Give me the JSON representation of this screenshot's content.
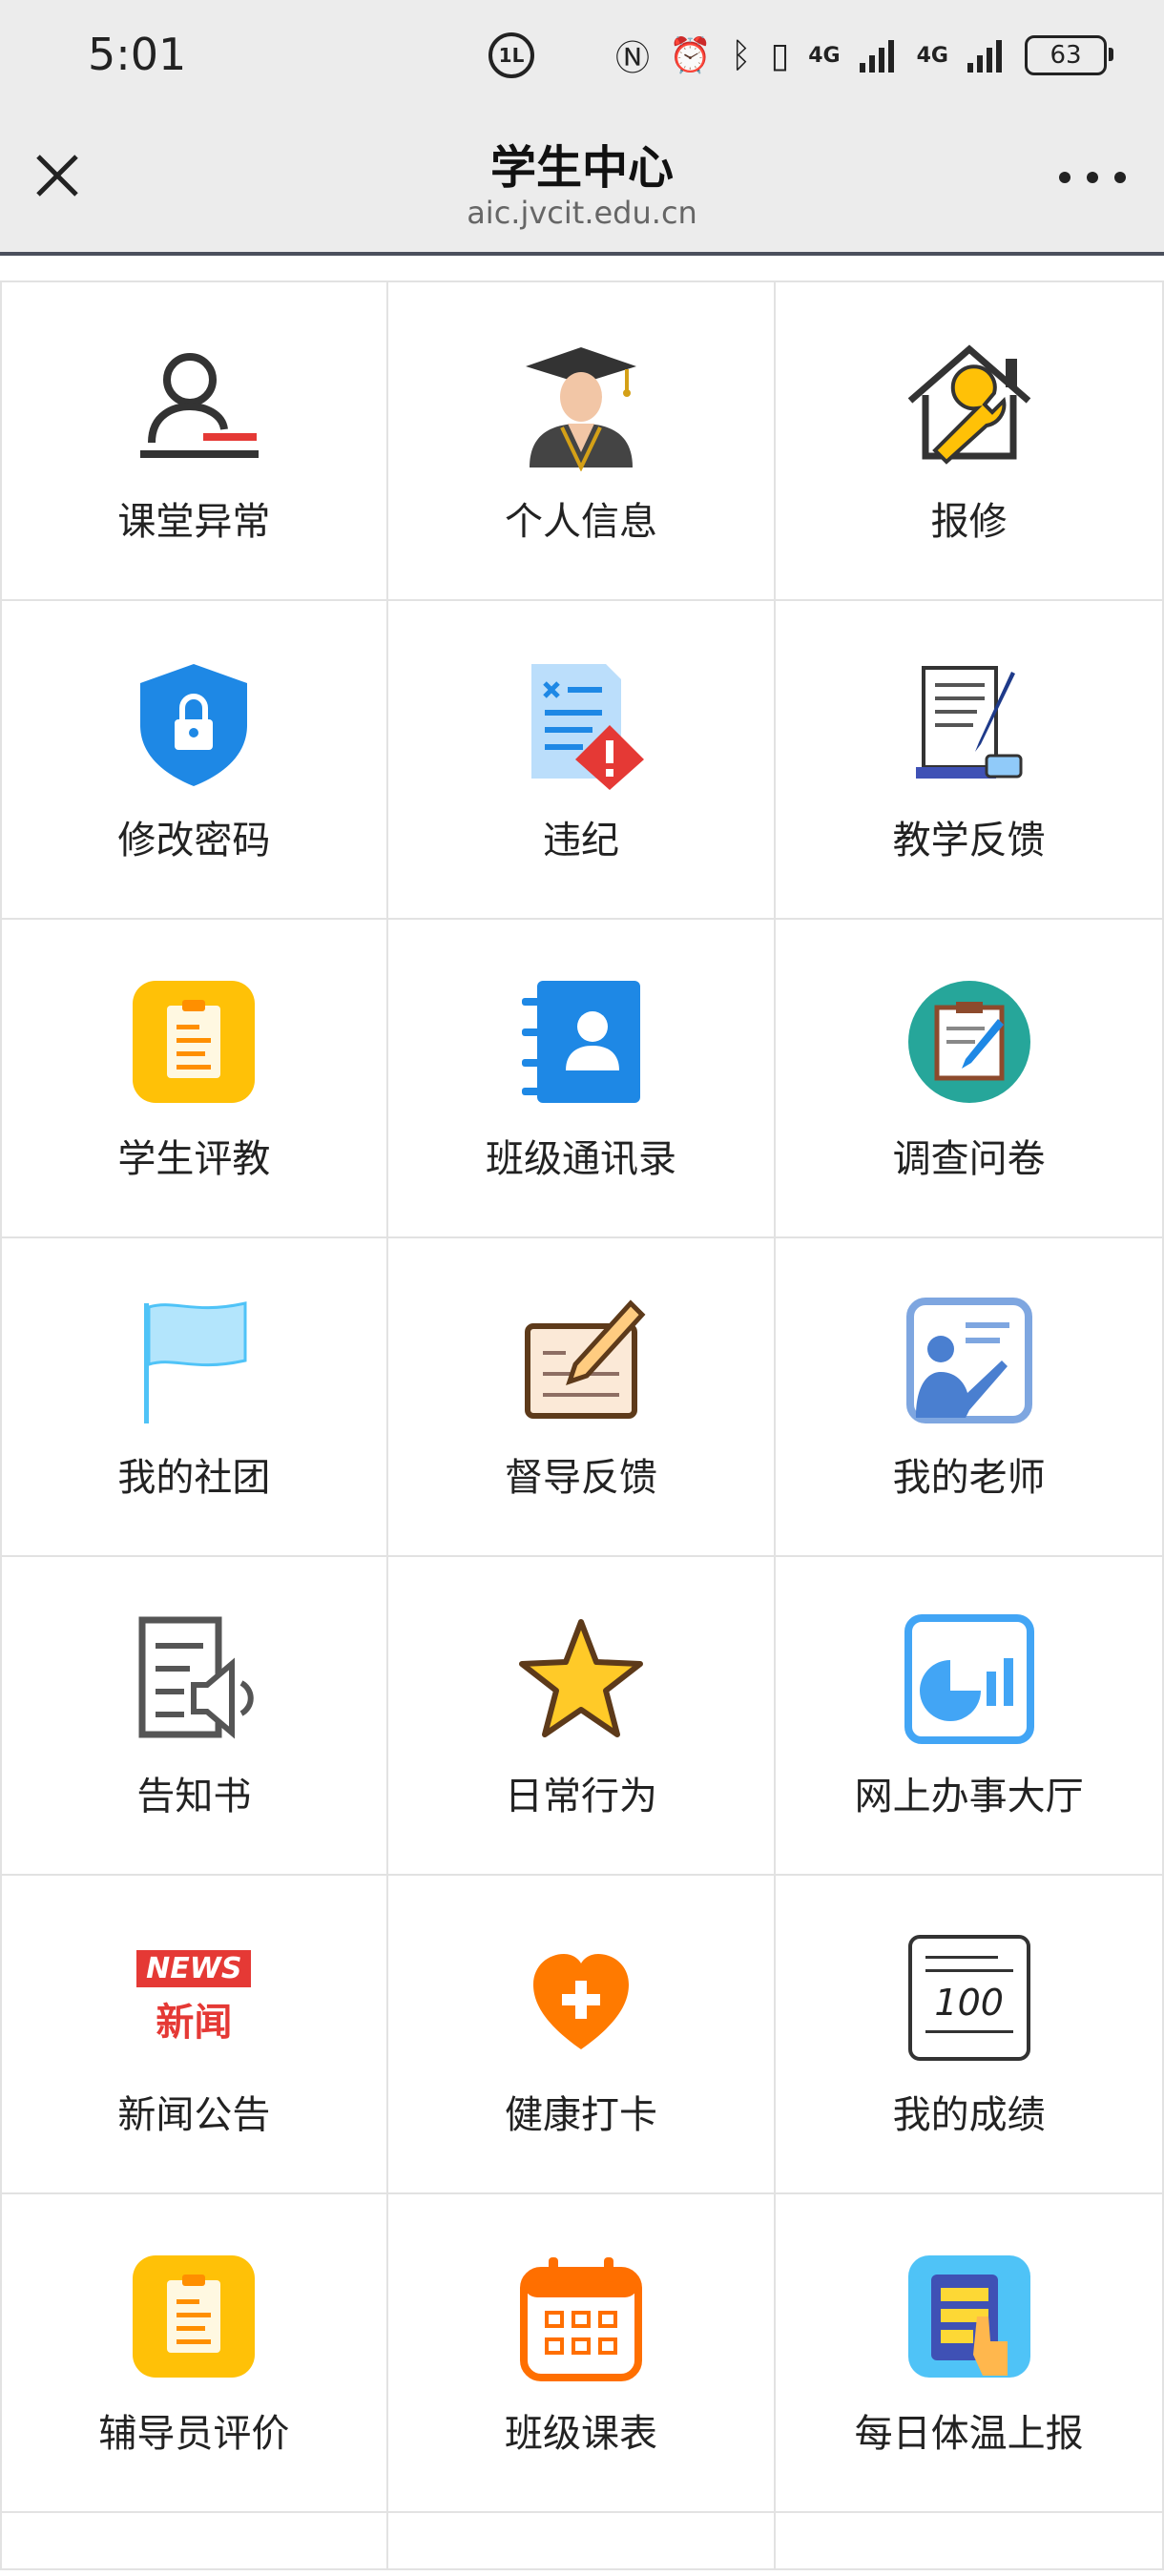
{
  "status_bar": {
    "time": "5:01",
    "net1": "4G",
    "net2": "4G",
    "battery": "63",
    "dnd_label": "1L"
  },
  "header": {
    "title": "学生中心",
    "url": "aic.jvcit.edu.cn"
  },
  "grid": {
    "items": [
      {
        "label": "课堂异常",
        "icon": "person-red-line-icon"
      },
      {
        "label": "个人信息",
        "icon": "graduate-icon"
      },
      {
        "label": "报修",
        "icon": "house-wrench-icon"
      },
      {
        "label": "修改密码",
        "icon": "shield-lock-icon"
      },
      {
        "label": "违纪",
        "icon": "document-warning-icon"
      },
      {
        "label": "教学反馈",
        "icon": "scroll-pen-icon"
      },
      {
        "label": "学生评教",
        "icon": "clipboard-yellow-icon"
      },
      {
        "label": "班级通讯录",
        "icon": "contact-book-icon"
      },
      {
        "label": "调查问卷",
        "icon": "survey-circle-icon"
      },
      {
        "label": "我的社团",
        "icon": "flag-icon"
      },
      {
        "label": "督导反馈",
        "icon": "notebook-pen-icon"
      },
      {
        "label": "我的老师",
        "icon": "teacher-board-icon"
      },
      {
        "label": "告知书",
        "icon": "notice-speaker-icon"
      },
      {
        "label": "日常行为",
        "icon": "star-icon"
      },
      {
        "label": "网上办事大厅",
        "icon": "chart-square-icon"
      },
      {
        "label": "新闻公告",
        "icon": "news-icon"
      },
      {
        "label": "健康打卡",
        "icon": "heart-plus-icon"
      },
      {
        "label": "我的成绩",
        "icon": "score-paper-icon"
      },
      {
        "label": "辅导员评价",
        "icon": "clipboard-yellow-icon"
      },
      {
        "label": "班级课表",
        "icon": "calendar-icon"
      },
      {
        "label": "每日体温上报",
        "icon": "tablet-hand-icon"
      }
    ],
    "news_badge": "NEWS",
    "news_text": "新闻",
    "score_text": "100"
  },
  "colors": {
    "blue": "#1e88e5",
    "orange": "#ff6f00",
    "yellow": "#ffc107",
    "teal": "#26a69a",
    "red": "#e53935"
  }
}
